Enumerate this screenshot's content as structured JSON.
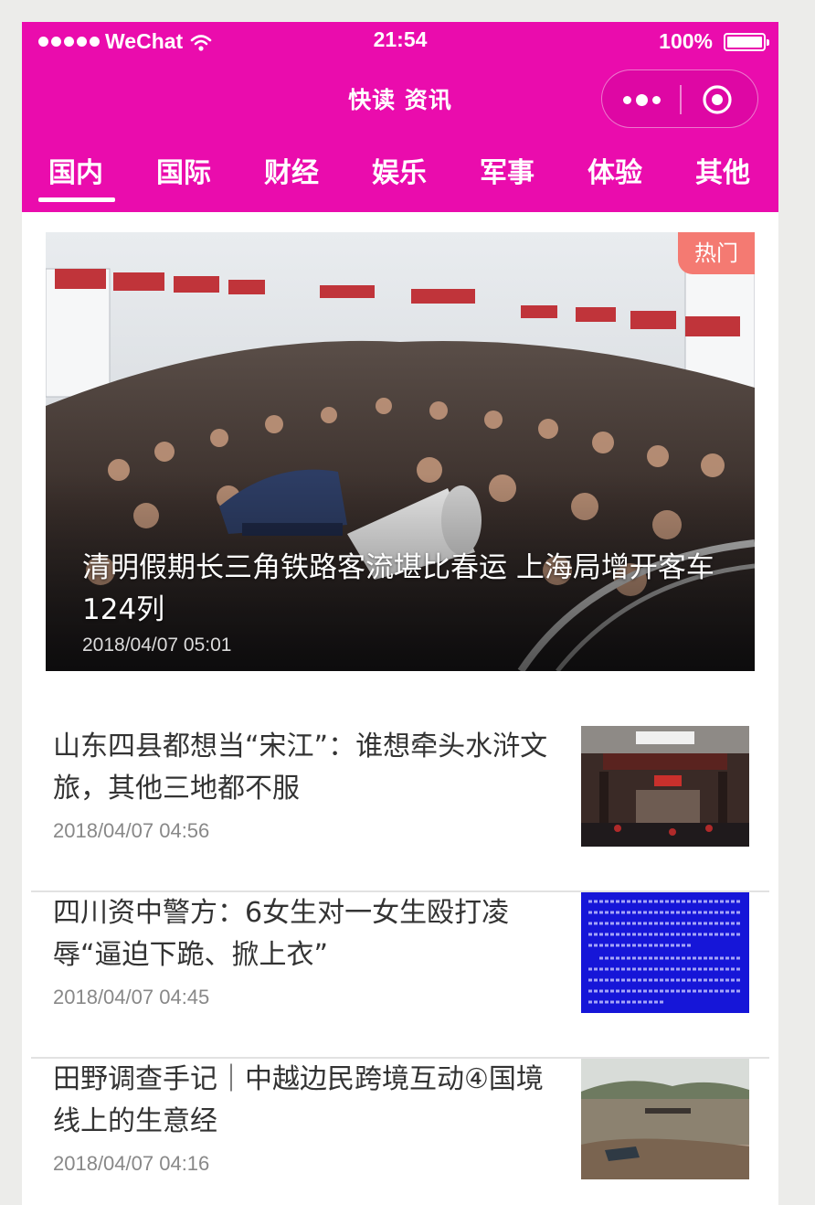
{
  "status_bar": {
    "carrier": "WeChat",
    "time": "21:54",
    "battery": "100%"
  },
  "navbar": {
    "title": "快读 资讯"
  },
  "tabs": [
    {
      "label": "国内",
      "active": true
    },
    {
      "label": "国际",
      "active": false
    },
    {
      "label": "财经",
      "active": false
    },
    {
      "label": "娱乐",
      "active": false
    },
    {
      "label": "军事",
      "active": false
    },
    {
      "label": "体验",
      "active": false
    },
    {
      "label": "其他",
      "active": false
    }
  ],
  "featured": {
    "badge": "热门",
    "title": "清明假期长三角铁路客流堪比春运 上海局增开客车124列",
    "date": "2018/04/07 05:01"
  },
  "news": [
    {
      "title": "山东四县都想当“宋江”：谁想牵头水浒文旅，其他三地都不服",
      "date": "2018/04/07 04:56"
    },
    {
      "title": "四川资中警方：6女生对一女生殴打凌辱“逼迫下跪、掀上衣”",
      "date": "2018/04/07 04:45"
    },
    {
      "title": "田野调查手记｜中越边民跨境互动④国境线上的生意经",
      "date": "2018/04/07 04:16"
    }
  ],
  "colors": {
    "brand": "#ea0cad",
    "hot_badge": "#f47a72",
    "title_text": "#333333",
    "date_text": "#888888"
  }
}
